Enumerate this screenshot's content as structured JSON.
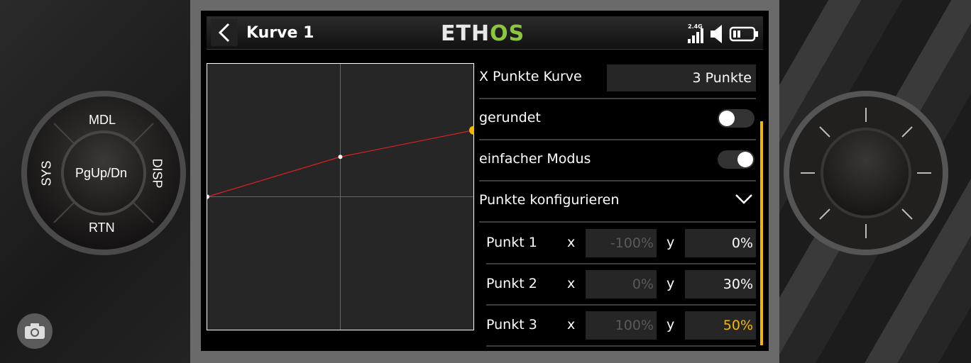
{
  "header": {
    "title": "Kurve 1",
    "logo_left": "ETH",
    "logo_right": "OS",
    "rf_band": "2.4G"
  },
  "hardware": {
    "mdl": "MDL",
    "sys": "SYS",
    "disp": "DISP",
    "rtn": "RTN",
    "center": "PgUp/Dn"
  },
  "chart_data": {
    "type": "line",
    "x": [
      -100,
      0,
      100
    ],
    "y": [
      0,
      30,
      50
    ],
    "xlim": [
      -100,
      100
    ],
    "ylim": [
      -100,
      100
    ],
    "grid": true,
    "line_color": "#e02020",
    "point_color": "#ffffff",
    "active_point_color": "#f5b800"
  },
  "settings": {
    "points_label": "X Punkte Kurve",
    "points_value": "3 Punkte",
    "smooth_label": "gerundet",
    "smooth_on": false,
    "easy_label": "einfacher Modus",
    "easy_on": true,
    "configure_label": "Punkte konfigurieren"
  },
  "points": [
    {
      "label": "Punkt 1",
      "x_axis": "x",
      "x": "-100%",
      "y_axis": "y",
      "y": "0%"
    },
    {
      "label": "Punkt 2",
      "x_axis": "x",
      "x": "0%",
      "y_axis": "y",
      "y": "30%"
    },
    {
      "label": "Punkt 3",
      "x_axis": "x",
      "x": "100%",
      "y_axis": "y",
      "y": "50%"
    }
  ],
  "colors": {
    "accent": "#f5b800",
    "logo_green": "#8cc63f"
  }
}
